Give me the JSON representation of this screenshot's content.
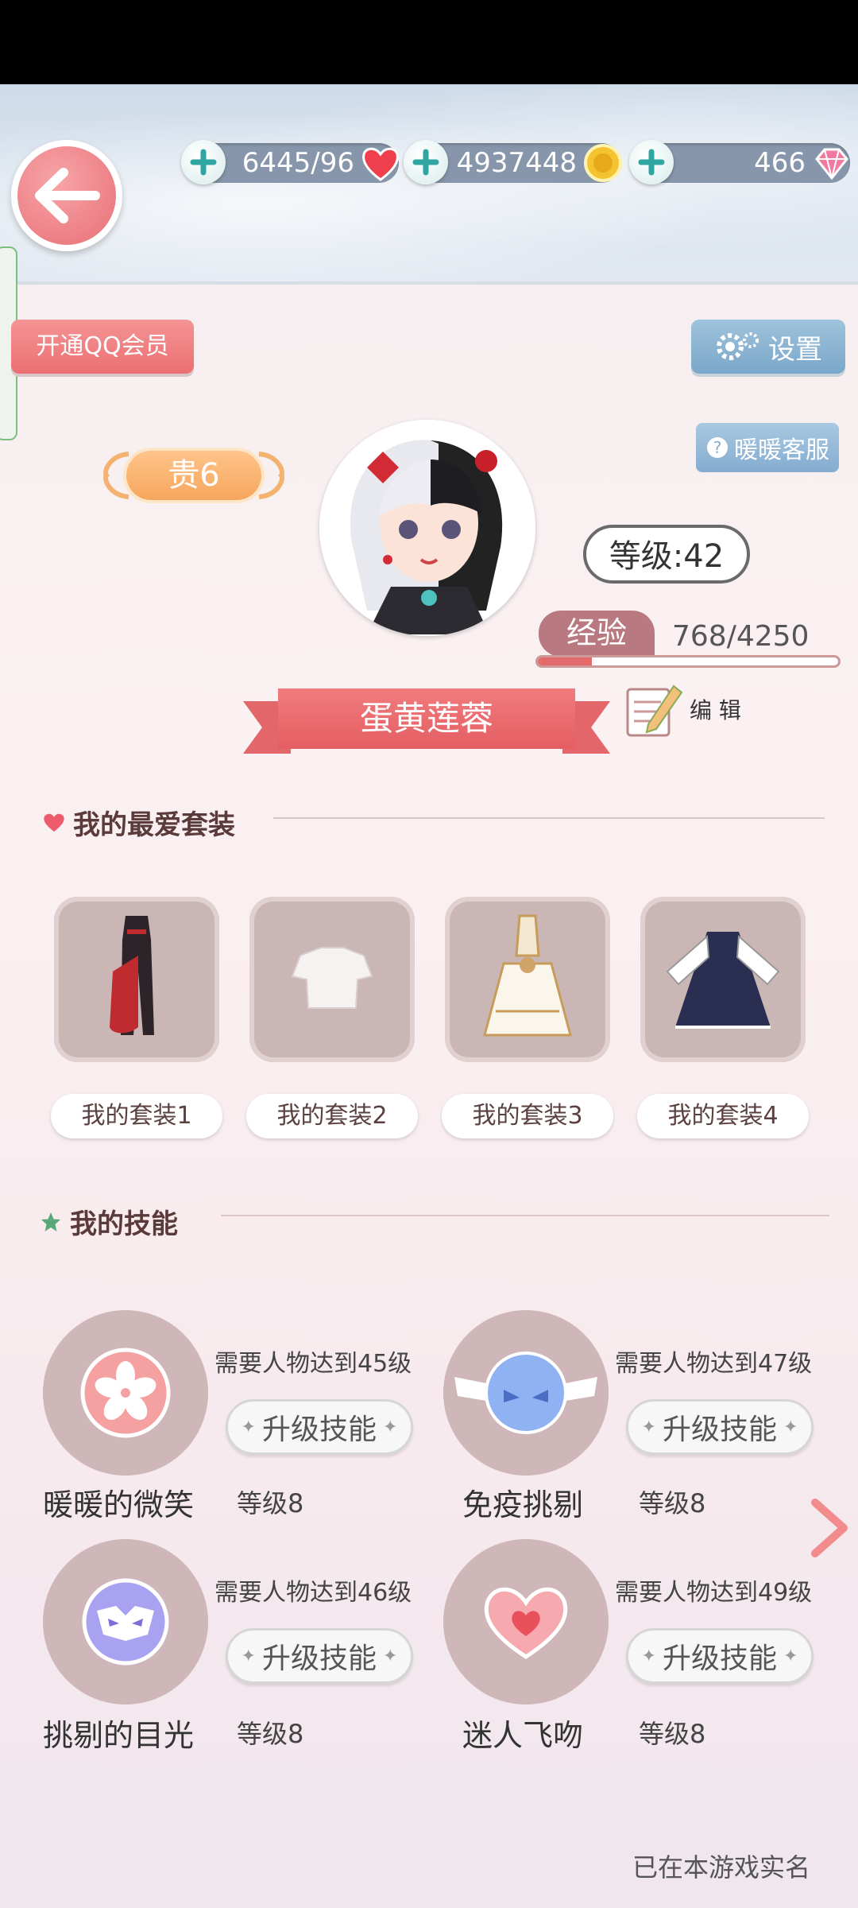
{
  "header": {
    "currencies": [
      {
        "value": "6445/96",
        "icon": "heart-icon"
      },
      {
        "value": "4937448",
        "icon": "gold-coin-icon"
      },
      {
        "value": "466",
        "icon": "diamond-icon"
      }
    ]
  },
  "buttons": {
    "qq_member": "开通QQ会员",
    "settings": "设置",
    "customer_service": "暖暖客服"
  },
  "profile": {
    "vip": "贵6",
    "level": "等级:42",
    "exp_label": "经验",
    "exp_value": "768/4250",
    "exp_progress": 0.18,
    "name": "蛋黄莲蓉",
    "edit": "编 辑"
  },
  "favorites": {
    "title": "我的最爱套装",
    "items": [
      {
        "label": "我的套装1"
      },
      {
        "label": "我的套装2"
      },
      {
        "label": "我的套装3"
      },
      {
        "label": "我的套装4"
      }
    ]
  },
  "skills": {
    "title": "我的技能",
    "upgrade_label": "升级技能",
    "items": [
      {
        "name": "暖暖的微笑",
        "requirement": "需要人物达到45级",
        "level": "等级8",
        "icon": "sakura-icon"
      },
      {
        "name": "免疫挑剔",
        "requirement": "需要人物达到47级",
        "level": "等级8",
        "icon": "winged-mask-icon"
      },
      {
        "name": "挑剔的目光",
        "requirement": "需要人物达到46级",
        "level": "等级8",
        "icon": "mask-icon"
      },
      {
        "name": "迷人飞吻",
        "requirement": "需要人物达到49级",
        "level": "等级8",
        "icon": "heart-kiss-icon"
      }
    ]
  },
  "footer": {
    "realname": "已在本游戏实名"
  },
  "colors": {
    "accent_red": "#e45e62",
    "settings_blue": "#7aa7c9",
    "vip_orange": "#f6a65d"
  }
}
